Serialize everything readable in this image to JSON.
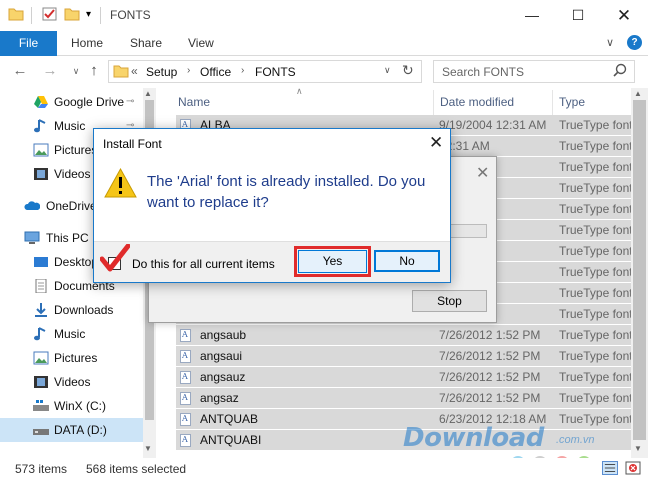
{
  "window": {
    "title": "FONTS",
    "minimize_glyph": "—",
    "maximize_glyph": "☐",
    "close_glyph": "✕"
  },
  "ribbon": {
    "tabs": [
      {
        "label": "File"
      },
      {
        "label": "Home"
      },
      {
        "label": "Share"
      },
      {
        "label": "View"
      }
    ],
    "expand_glyph": "∨",
    "help_glyph": "?"
  },
  "address": {
    "overflow_glyph": "«",
    "crumbs": [
      "Setup",
      "Office",
      "FONTS"
    ],
    "separator": "›",
    "dropdown_glyph": "∨",
    "refresh_glyph": "↻"
  },
  "search": {
    "placeholder": "Search FONTS"
  },
  "nav_pane": {
    "items": [
      {
        "label": "Google Drive",
        "icon": "google-drive-icon",
        "pinned": true
      },
      {
        "label": "Music",
        "icon": "music-icon",
        "pinned": true
      },
      {
        "label": "Pictures",
        "icon": "pictures-icon",
        "pinned": true
      },
      {
        "label": "Videos",
        "icon": "videos-icon",
        "pinned": false
      },
      {
        "label": "OneDrive",
        "icon": "onedrive-icon",
        "pinned": false
      },
      {
        "label": "This PC",
        "icon": "this-pc-icon",
        "pinned": false
      },
      {
        "label": "Desktop",
        "icon": "desktop-icon",
        "pinned": false
      },
      {
        "label": "Documents",
        "icon": "documents-icon",
        "pinned": false
      },
      {
        "label": "Downloads",
        "icon": "downloads-icon",
        "pinned": false
      },
      {
        "label": "Music",
        "icon": "music-icon",
        "pinned": false
      },
      {
        "label": "Pictures",
        "icon": "pictures-icon",
        "pinned": false
      },
      {
        "label": "Videos",
        "icon": "videos-icon",
        "pinned": false
      },
      {
        "label": "WinX (C:)",
        "icon": "drive-c-icon",
        "pinned": false
      },
      {
        "label": "DATA (D:)",
        "icon": "drive-d-icon",
        "pinned": false,
        "selected": true
      }
    ],
    "pin_glyph": "📌"
  },
  "file_list": {
    "columns": [
      "Name",
      "Date modified",
      "Type"
    ],
    "rows": [
      {
        "name": "ALBA",
        "date": "9/19/2004 12:31 AM",
        "type": "TrueType font"
      },
      {
        "name": "",
        "date": "12:31 AM",
        "type": "TrueType font"
      },
      {
        "name": "",
        "date": "12:31 AM",
        "type": "TrueType font"
      },
      {
        "name": "",
        "date": "1:52 PM",
        "type": "TrueType font"
      },
      {
        "name": "",
        "date": "2:13 AM",
        "type": "TrueType font"
      },
      {
        "name": "",
        "date": "1:52 PM",
        "type": "TrueType font"
      },
      {
        "name": "",
        "date": "1:52 PM",
        "type": "TrueType font"
      },
      {
        "name": "",
        "date": "1:52 PM",
        "type": "TrueType font"
      },
      {
        "name": "",
        "date": "1:52 PM",
        "type": "TrueType font"
      },
      {
        "name": "",
        "date": "1:52 PM",
        "type": "TrueType font"
      },
      {
        "name": "angsaub",
        "date": "7/26/2012 1:52 PM",
        "type": "TrueType font"
      },
      {
        "name": "angsaui",
        "date": "7/26/2012 1:52 PM",
        "type": "TrueType font"
      },
      {
        "name": "angsauz",
        "date": "7/26/2012 1:52 PM",
        "type": "TrueType font"
      },
      {
        "name": "angsaz",
        "date": "7/26/2012 1:52 PM",
        "type": "TrueType font"
      },
      {
        "name": "ANTQUAB",
        "date": "6/23/2012 12:18 AM",
        "type": "TrueType font"
      },
      {
        "name": "ANTQUABI",
        "date": "",
        "type": ""
      }
    ]
  },
  "status": {
    "count": "573 items",
    "selected": "568 items selected"
  },
  "copy_dialog": {
    "close_glyph": "✕",
    "stop_label": "Stop"
  },
  "font_dialog": {
    "title": "Install Font",
    "close_glyph": "✕",
    "message": "The 'Arial' font is already installed. Do you want to replace it?",
    "checkbox_label": "Do this for all current items",
    "yes_label": "Yes",
    "no_label": "No"
  },
  "watermark": {
    "text": "Download",
    "domain": ".com.vn"
  },
  "colors": {
    "accent": "#1979ca",
    "selection": "#cce4f7",
    "warning": "#f5c518",
    "highlight_red": "#e02b2b"
  }
}
